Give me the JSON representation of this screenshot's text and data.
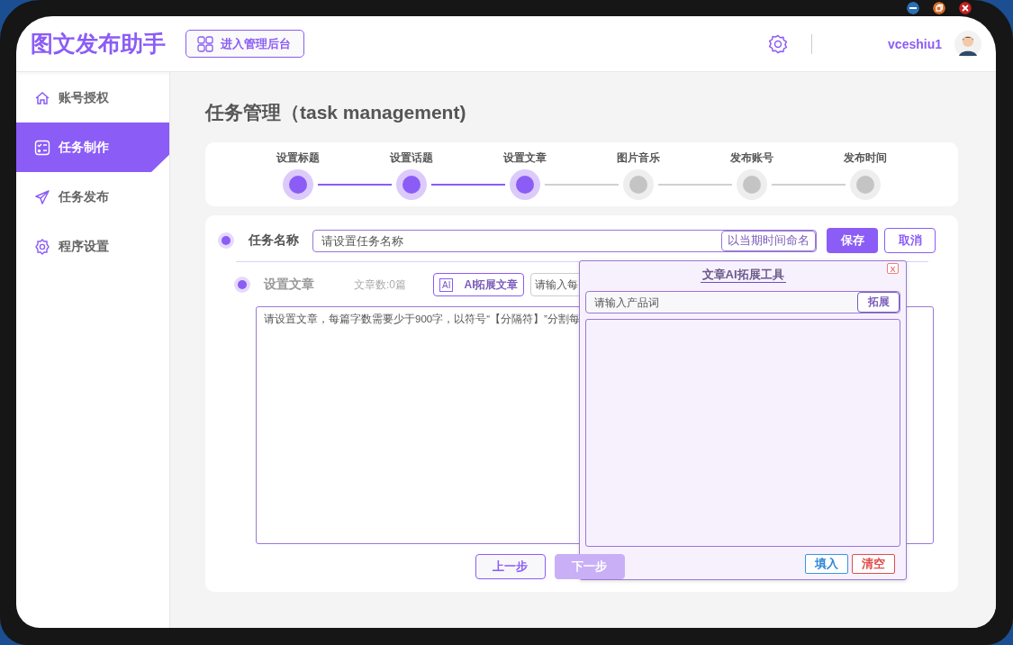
{
  "app": {
    "title": "图文发布助手",
    "admin_button": "进入管理后台",
    "username": "vceshiu1"
  },
  "sidebar": {
    "items": [
      {
        "label": "账号授权",
        "selected": false
      },
      {
        "label": "任务制作",
        "selected": true
      },
      {
        "label": "任务发布",
        "selected": false
      },
      {
        "label": "程序设置",
        "selected": false
      }
    ]
  },
  "page": {
    "title": "任务管理（task management)"
  },
  "steps": [
    {
      "label": "设置标题",
      "done": true
    },
    {
      "label": "设置话题",
      "done": true
    },
    {
      "label": "设置文章",
      "done": true
    },
    {
      "label": "图片音乐",
      "done": false
    },
    {
      "label": "发布账号",
      "done": false
    },
    {
      "label": "发布时间",
      "done": false
    }
  ],
  "form": {
    "name_label": "任务名称",
    "name_checked": true,
    "name_placeholder": "请设置任务名称",
    "name_button": "以当期时间命名",
    "save": "保存",
    "cancel": "取消",
    "article_label": "设置文章",
    "article_checked": true,
    "article_count": "文章数:0篇",
    "ai_icon": "AI",
    "ai_button": "AI拓展文章",
    "max_placeholder": "请输入每",
    "article_placeholder": "请设置文章，每篇字数需要少于900字，以符号“【分隔符】”分割每",
    "prev": "上一步",
    "next": "下一步",
    "next_disabled": true
  },
  "ai_tool": {
    "title": "文章AI拓展工具",
    "close": "X",
    "placeholder": "请输入产品词",
    "expand": "拓展",
    "fill": "填入",
    "clear": "清空"
  }
}
